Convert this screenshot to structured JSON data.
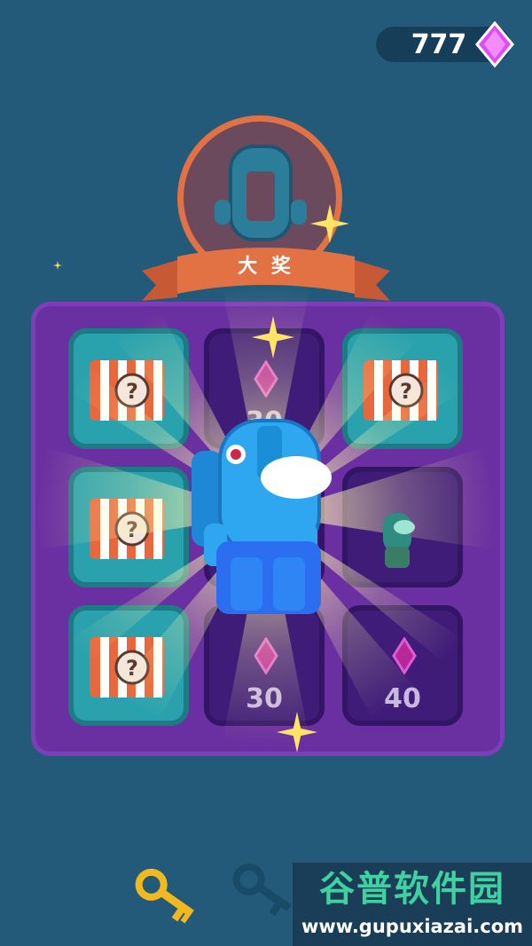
{
  "currency": {
    "gems": "777",
    "icon": "pink-gem-icon",
    "color": "#e04cf0"
  },
  "grand_prize": {
    "label": "大 奖"
  },
  "board": {
    "tiles": [
      {
        "row": 1,
        "col": 1,
        "type": "mystery-crate"
      },
      {
        "row": 1,
        "col": 2,
        "type": "gems",
        "value": "30"
      },
      {
        "row": 1,
        "col": 3,
        "type": "mystery-crate"
      },
      {
        "row": 2,
        "col": 1,
        "type": "mystery-crate"
      },
      {
        "row": 2,
        "col": 2,
        "type": "character-reward"
      },
      {
        "row": 2,
        "col": 3,
        "type": "character"
      },
      {
        "row": 3,
        "col": 1,
        "type": "mystery-crate"
      },
      {
        "row": 3,
        "col": 2,
        "type": "gems",
        "value": "30"
      },
      {
        "row": 3,
        "col": 3,
        "type": "gems",
        "value": "40"
      }
    ]
  },
  "keys": {
    "collected": 1,
    "total": 3
  },
  "watermark": {
    "title": "谷普软件园",
    "url": "www.gupuxiazai.com"
  }
}
